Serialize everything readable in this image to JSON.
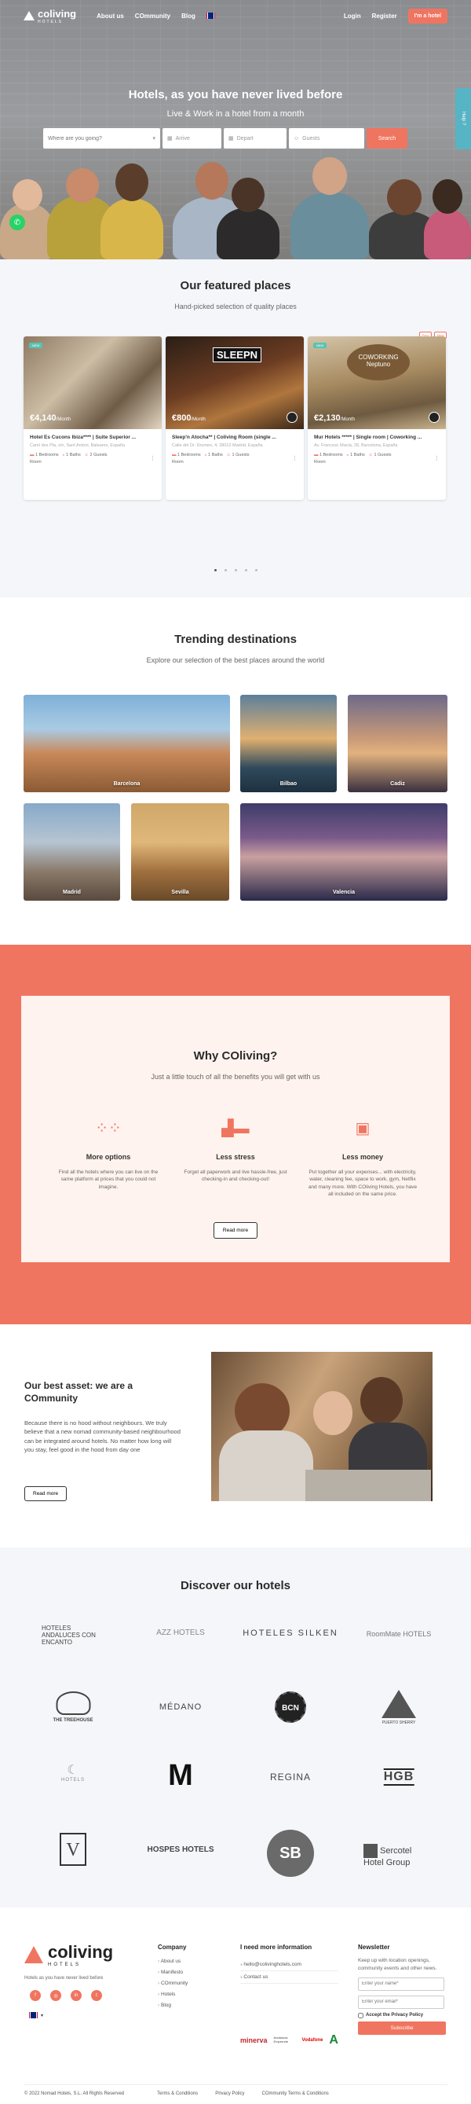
{
  "nav": {
    "brand": "coliving",
    "brand_sub": "HOTELS",
    "links": [
      "About us",
      "COmmunity",
      "Blog"
    ],
    "login": "Login",
    "register": "Register",
    "cta": "I'm a hotel"
  },
  "hero": {
    "title": "Hotels, as you have never lived before",
    "subtitle": "Live & Work in a hotel from a month",
    "where_placeholder": "Where are you going?",
    "arrive": "Arrive",
    "depart": "Depart",
    "guests": "Guests",
    "search": "Search",
    "help": "Help ?"
  },
  "featured": {
    "title": "Our featured places",
    "subtitle": "Hand-picked selection of quality places",
    "tags": [
      "Prev",
      "Next"
    ],
    "cards": [
      {
        "price": "€4,140",
        "per": "/Month",
        "badge": "",
        "title": "Hotel Es Cucons Ibiza**** | Suite Superior ...",
        "address": "Camí des Pla, s/n, Sant Antoni, Baleares, España",
        "beds": "1 Bedrooms",
        "baths": "1 Baths",
        "guests": "2 Guests",
        "type": "Room"
      },
      {
        "price": "€800",
        "per": "/Month",
        "badge": "",
        "title": "Sleep'n Atocha** | Coliving Room (single ...",
        "address": "Calle del Dr. Drumen, 4, 28012 Madrid, España",
        "beds": "1 Bedrooms",
        "baths": "1 Baths",
        "guests": "1 Guests",
        "type": "Room"
      },
      {
        "price": "€2,130",
        "per": "/Month",
        "badge": "",
        "title": "Mur Hotels ***** | Single room | Coworking ...",
        "address": "Av. Francesc Macià, 28, Barcelona, España",
        "beds": "1 Bedrooms",
        "baths": "1 Baths",
        "guests": "1 Guests",
        "type": "Room"
      }
    ]
  },
  "trending": {
    "title": "Trending destinations",
    "subtitle": "Explore our selection of the best places around the world",
    "destinations": [
      "Barcelona",
      "Bilbao",
      "Cadiz",
      "Madrid",
      "Sevilla",
      "Valencia"
    ]
  },
  "why": {
    "title": "Why COliving?",
    "subtitle": "Just a little touch of all the benefits you will get with us",
    "items": [
      {
        "icon": "grid-dots-icon",
        "title": "More options",
        "text": "Find all the hotels where you can live on the same platform at prices that you could not imagine."
      },
      {
        "icon": "bed-icon",
        "title": "Less stress",
        "text": "Forget all paperwork and live hassle-free, just checking-in and checking-out!"
      },
      {
        "icon": "money-icon",
        "title": "Less money",
        "text": "Put together all your expenses... with electricity, water, cleaning fee, space to work, gym, Netflix and many more. With COliving Hotels, you have all included on the same price."
      }
    ],
    "button": "Read more"
  },
  "asset": {
    "title": "Our best asset: we are a COmmunity",
    "text": "Because there is no hood without neighbours. We truly believe that a new nomad community-based neighbourhood can be integrated around hotels. No matter how long will you stay, feel good in the hood from day one",
    "button": "Read more"
  },
  "hotels": {
    "title": "Discover our hotels",
    "logos": [
      "HOTELES ANDALUCES CON ENCANTO",
      "AZZ HOTELS",
      "HOTELES SILKEN",
      "RoomMate HOTELS",
      "THE TREEHOUSE",
      "MÉDANO",
      "BCN",
      "PUERTO SHERRY",
      "HOTELS",
      "M",
      "REGINA",
      "HGB",
      "V",
      "HOSPES HOTELS",
      "SB",
      "Sercotel Hotel Group"
    ]
  },
  "footer": {
    "brand": "coliving",
    "brand_sub": "HOTELS",
    "tagline": "Hotels as you have never lived before",
    "company_title": "Company",
    "company_links": [
      "About us",
      "Manifesto",
      "COmmunity",
      "Hotels",
      "Blog"
    ],
    "info_title": "I need more information",
    "email": "hello@colivinghotels.com",
    "contact": "Contact us",
    "newsletter_title": "Newsletter",
    "newsletter_text": "Keep up with location openings, community events and other news.",
    "name_placeholder": "Enter your name*",
    "email_placeholder": "Enter your email*",
    "privacy": "Accept the Privacy Policy",
    "subscribe": "Subscribe",
    "sponsors": [
      "minerva",
      "Andalucía Emprende",
      "Vodafone",
      "A"
    ],
    "copyright": "© 2022 Nomad Hotels, S.L. All Rights Reserved",
    "bottom_links": [
      "Terms & Conditions",
      "Privacy Policy",
      "COmmunity Terms & Conditions"
    ]
  },
  "colors": {
    "accent": "#f07560",
    "teal": "#57b4c4",
    "light_bg": "#f4f6f9"
  }
}
